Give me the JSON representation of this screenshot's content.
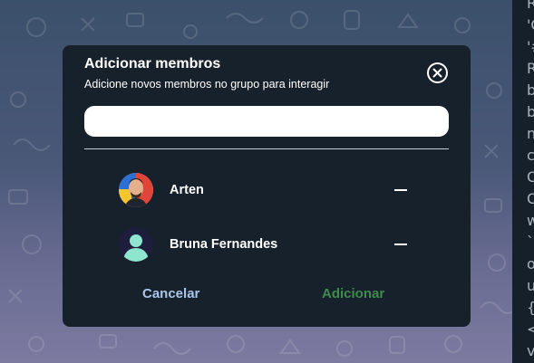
{
  "dialog": {
    "title": "Adicionar membros",
    "subtitle": "Adicione novos membros no grupo para interagir",
    "search": {
      "value": "",
      "placeholder": ""
    },
    "members": [
      {
        "name": "Arten",
        "action_icon": "minus-icon"
      },
      {
        "name": "Bruna Fernandes",
        "action_icon": "minus-icon"
      }
    ],
    "cancel_label": "Cancelar",
    "add_label": "Adicionar"
  },
  "side_panel": {
    "lines": [
      "R",
      "'C",
      "'#",
      "R",
      "b",
      "b",
      "n",
      "c",
      "C",
      "C",
      "w",
      "`",
      "o",
      "u",
      "{l",
      "<",
      "v"
    ]
  },
  "colors": {
    "modal_bg": "#17212c",
    "cancel": "#a9c6e9",
    "add": "#3f8c4d",
    "avatar_placeholder_bg": "#1e1e3c",
    "avatar_placeholder_fg": "#8fe6cf"
  }
}
